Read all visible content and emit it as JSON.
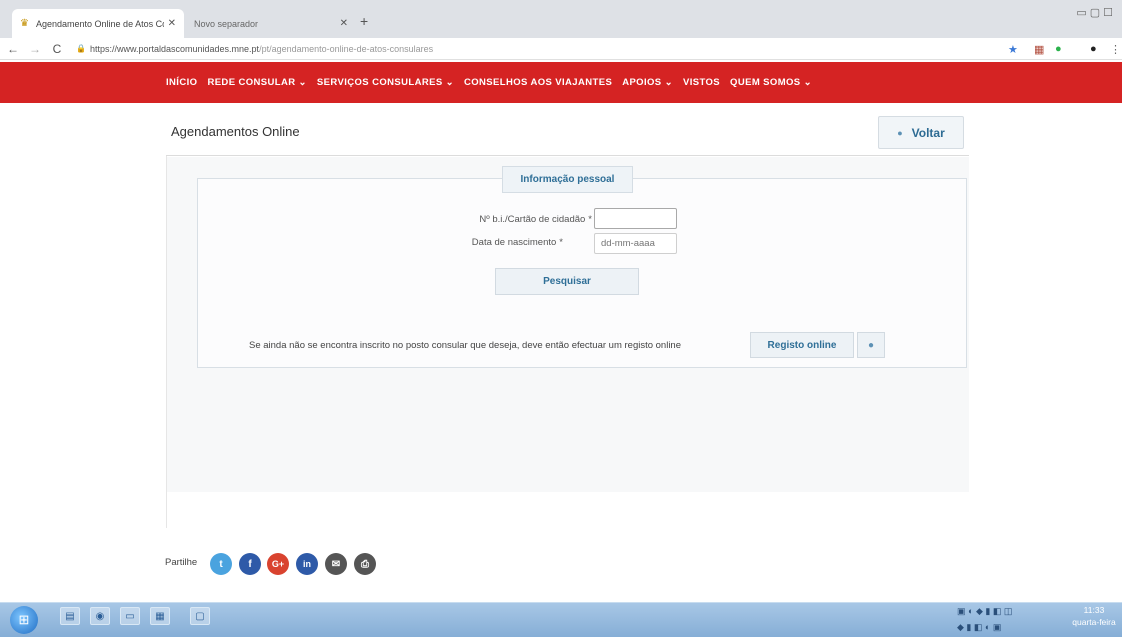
{
  "browser": {
    "tabs": [
      {
        "title": "Agendamento Online de Atos Cons.",
        "active": true
      },
      {
        "title": "Novo separador",
        "active": false
      }
    ],
    "url_host": "https://www.portaldascomunidades.mne.pt",
    "url_path": "/pt/agendamento-online-de-atos-consulares"
  },
  "nav": {
    "items": [
      "INÍCIO",
      "REDE CONSULAR ⌄",
      "SERVIÇOS CONSULARES ⌄",
      "CONSELHOS AOS VIAJANTES",
      "APOIOS ⌄",
      "VISTOS",
      "QUEM SOMOS ⌄"
    ]
  },
  "page": {
    "title": "Agendamentos Online",
    "back_label": "Voltar"
  },
  "form": {
    "legend": "Informação pessoal",
    "id_label": "Nº b.i./Cartão de cidadão",
    "id_value": "",
    "dob_label": "Data de nascimento",
    "dob_placeholder": "dd-mm-aaaa",
    "required_mark": "*",
    "search_label": "Pesquisar",
    "register_text": "Se ainda não se encontra inscrito no posto consular que deseja, deve então efectuar um registo online",
    "register_label": "Registo online"
  },
  "share": {
    "label": "Partilhe",
    "networks": [
      {
        "name": "twitter",
        "glyph": "t",
        "color": "#4aa3df"
      },
      {
        "name": "facebook",
        "glyph": "f",
        "color": "#2e5aa8"
      },
      {
        "name": "google-plus",
        "glyph": "G+",
        "color": "#d9432f"
      },
      {
        "name": "linkedin",
        "glyph": "in",
        "color": "#2e5aa8"
      },
      {
        "name": "email",
        "glyph": "✉",
        "color": "#555555"
      },
      {
        "name": "print",
        "glyph": "⎙",
        "color": "#555555"
      }
    ]
  },
  "taskbar": {
    "time": "11:33",
    "day": "quarta-feira"
  },
  "colors": {
    "nav_red": "#d52323",
    "accent_blue": "#2f6f97"
  }
}
